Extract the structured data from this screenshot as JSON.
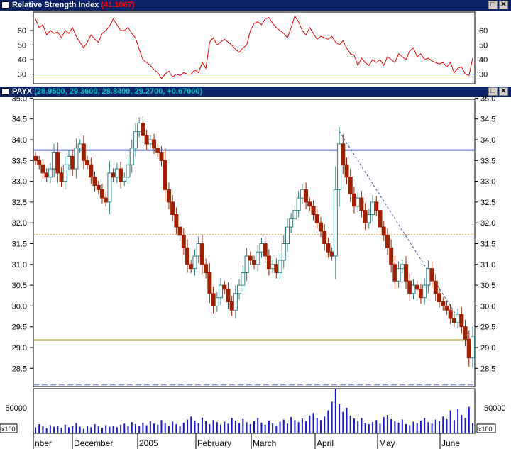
{
  "rsi_panel": {
    "title": "Relative Strength Index",
    "value": "(41.1067)",
    "value_color": "#ff0000"
  },
  "price_panel": {
    "symbol": "PAYX",
    "quote": "(28.9500, 29.3600, 28.8400, 29.2700, +0.67000)",
    "quote_color": "#00c0c0"
  },
  "window_buttons": {
    "maximize": "□",
    "close": "✕"
  },
  "volume_panel": {
    "scale_label": "x100"
  },
  "chart_data": [
    {
      "type": "line",
      "title": "Relative Strength Index",
      "ylim": [
        26,
        70
      ],
      "yticks": [
        30,
        40,
        50,
        60
      ],
      "reference_line": 30,
      "series": [
        {
          "values": [
            68,
            62,
            64,
            57,
            60,
            58,
            59,
            55,
            60,
            58,
            62,
            56,
            52,
            48,
            52,
            57,
            54,
            52,
            58,
            60,
            63,
            68,
            64,
            60,
            60,
            62,
            58,
            55,
            47,
            40,
            38,
            36,
            33,
            31,
            27,
            30,
            32,
            28,
            30,
            29,
            31,
            30,
            30,
            33,
            31,
            38,
            34,
            52,
            55,
            50,
            52,
            54,
            52,
            50,
            47,
            45,
            48,
            50,
            60,
            65,
            66,
            64,
            68,
            69,
            65,
            62,
            60,
            58,
            55,
            62,
            70,
            66,
            60,
            57,
            62,
            58,
            54,
            56,
            55,
            54,
            56,
            52,
            50,
            53,
            48,
            44,
            43,
            36,
            41,
            38,
            36,
            40,
            38,
            40,
            36,
            42,
            40,
            38,
            44,
            42,
            40,
            46,
            48,
            42,
            44,
            40,
            41,
            39,
            38,
            37,
            38,
            35,
            38,
            31,
            34,
            35,
            30,
            29,
            41
          ]
        }
      ]
    },
    {
      "type": "candlestick",
      "symbol": "PAYX",
      "ylim": [
        28.1,
        35.3
      ],
      "yticks": [
        28.5,
        29.0,
        29.5,
        30.0,
        30.5,
        31.0,
        31.5,
        32.0,
        32.5,
        33.0,
        33.5,
        34.0,
        34.5,
        35.0
      ],
      "x_labels": [
        "nber",
        "December",
        "2005",
        "February",
        "March",
        "April",
        "May",
        "June"
      ],
      "horizontal_lines": [
        33.75,
        31.72,
        29.18,
        28.1
      ],
      "trendline": {
        "from_bar": 82,
        "from_price": 34.2,
        "to_bar": 117,
        "to_price": 29.3
      },
      "closes": [
        33.5,
        33.4,
        33.2,
        33.1,
        33.3,
        33.7,
        33.2,
        33.0,
        33.4,
        33.6,
        33.3,
        33.8,
        33.9,
        33.5,
        33.4,
        33.1,
        32.9,
        32.8,
        32.6,
        32.5,
        33.2,
        33.1,
        33.3,
        33.0,
        33.1,
        33.4,
        33.8,
        34.2,
        34.4,
        34.1,
        33.9,
        34.0,
        33.8,
        33.7,
        33.5,
        32.8,
        32.5,
        32.2,
        31.9,
        31.7,
        31.4,
        31.0,
        30.9,
        31.2,
        31.5,
        31.0,
        30.8,
        30.3,
        30.0,
        30.2,
        30.5,
        30.4,
        30.1,
        29.9,
        30.3,
        30.5,
        30.8,
        31.2,
        31.1,
        31.0,
        31.3,
        31.5,
        31.2,
        30.9,
        31.0,
        30.8,
        31.1,
        31.5,
        31.9,
        32.1,
        32.3,
        32.6,
        32.8,
        32.5,
        32.4,
        32.2,
        32.0,
        31.8,
        31.5,
        31.3,
        31.2,
        32.8,
        33.9,
        33.4,
        33.1,
        32.7,
        32.4,
        32.6,
        32.3,
        32.0,
        32.2,
        32.5,
        32.3,
        31.9,
        31.7,
        31.4,
        31.0,
        30.6,
        30.9,
        31.0,
        30.6,
        30.3,
        30.5,
        30.4,
        30.2,
        30.5,
        30.9,
        30.6,
        30.3,
        30.1,
        30.0,
        29.9,
        29.7,
        29.6,
        29.8,
        29.5,
        29.2,
        28.75,
        29.27
      ]
    },
    {
      "type": "bar",
      "title": "Volume",
      "ylim": [
        0,
        100000
      ],
      "yticks": [
        50000
      ],
      "unit_label": "x100",
      "values": [
        12000,
        18000,
        14000,
        10000,
        16000,
        13000,
        15000,
        11000,
        17000,
        12000,
        14000,
        20000,
        13000,
        9000,
        15000,
        12000,
        18000,
        14000,
        11000,
        16000,
        13000,
        15000,
        12000,
        17000,
        19000,
        14000,
        22000,
        18000,
        15000,
        21000,
        16000,
        24000,
        19000,
        17000,
        26000,
        20000,
        15000,
        23000,
        18000,
        14000,
        21000,
        27000,
        33000,
        25000,
        20000,
        31000,
        24000,
        18000,
        26000,
        22000,
        17000,
        23000,
        19000,
        30000,
        25000,
        20000,
        28000,
        22000,
        18000,
        24000,
        30000,
        21000,
        17000,
        25000,
        20000,
        15000,
        23000,
        27000,
        19000,
        32000,
        26000,
        22000,
        29000,
        24000,
        35000,
        40000,
        30000,
        26000,
        33000,
        45000,
        62000,
        88000,
        58000,
        42000,
        50000,
        35000,
        29000,
        24000,
        30000,
        20000,
        18000,
        22000,
        26000,
        19000,
        32000,
        36000,
        28000,
        24000,
        21000,
        27000,
        18000,
        16000,
        23000,
        20000,
        25000,
        30000,
        22000,
        19000,
        27000,
        24000,
        33000,
        28000,
        45000,
        26000,
        48000,
        36000,
        30000,
        52000,
        20000
      ]
    }
  ]
}
